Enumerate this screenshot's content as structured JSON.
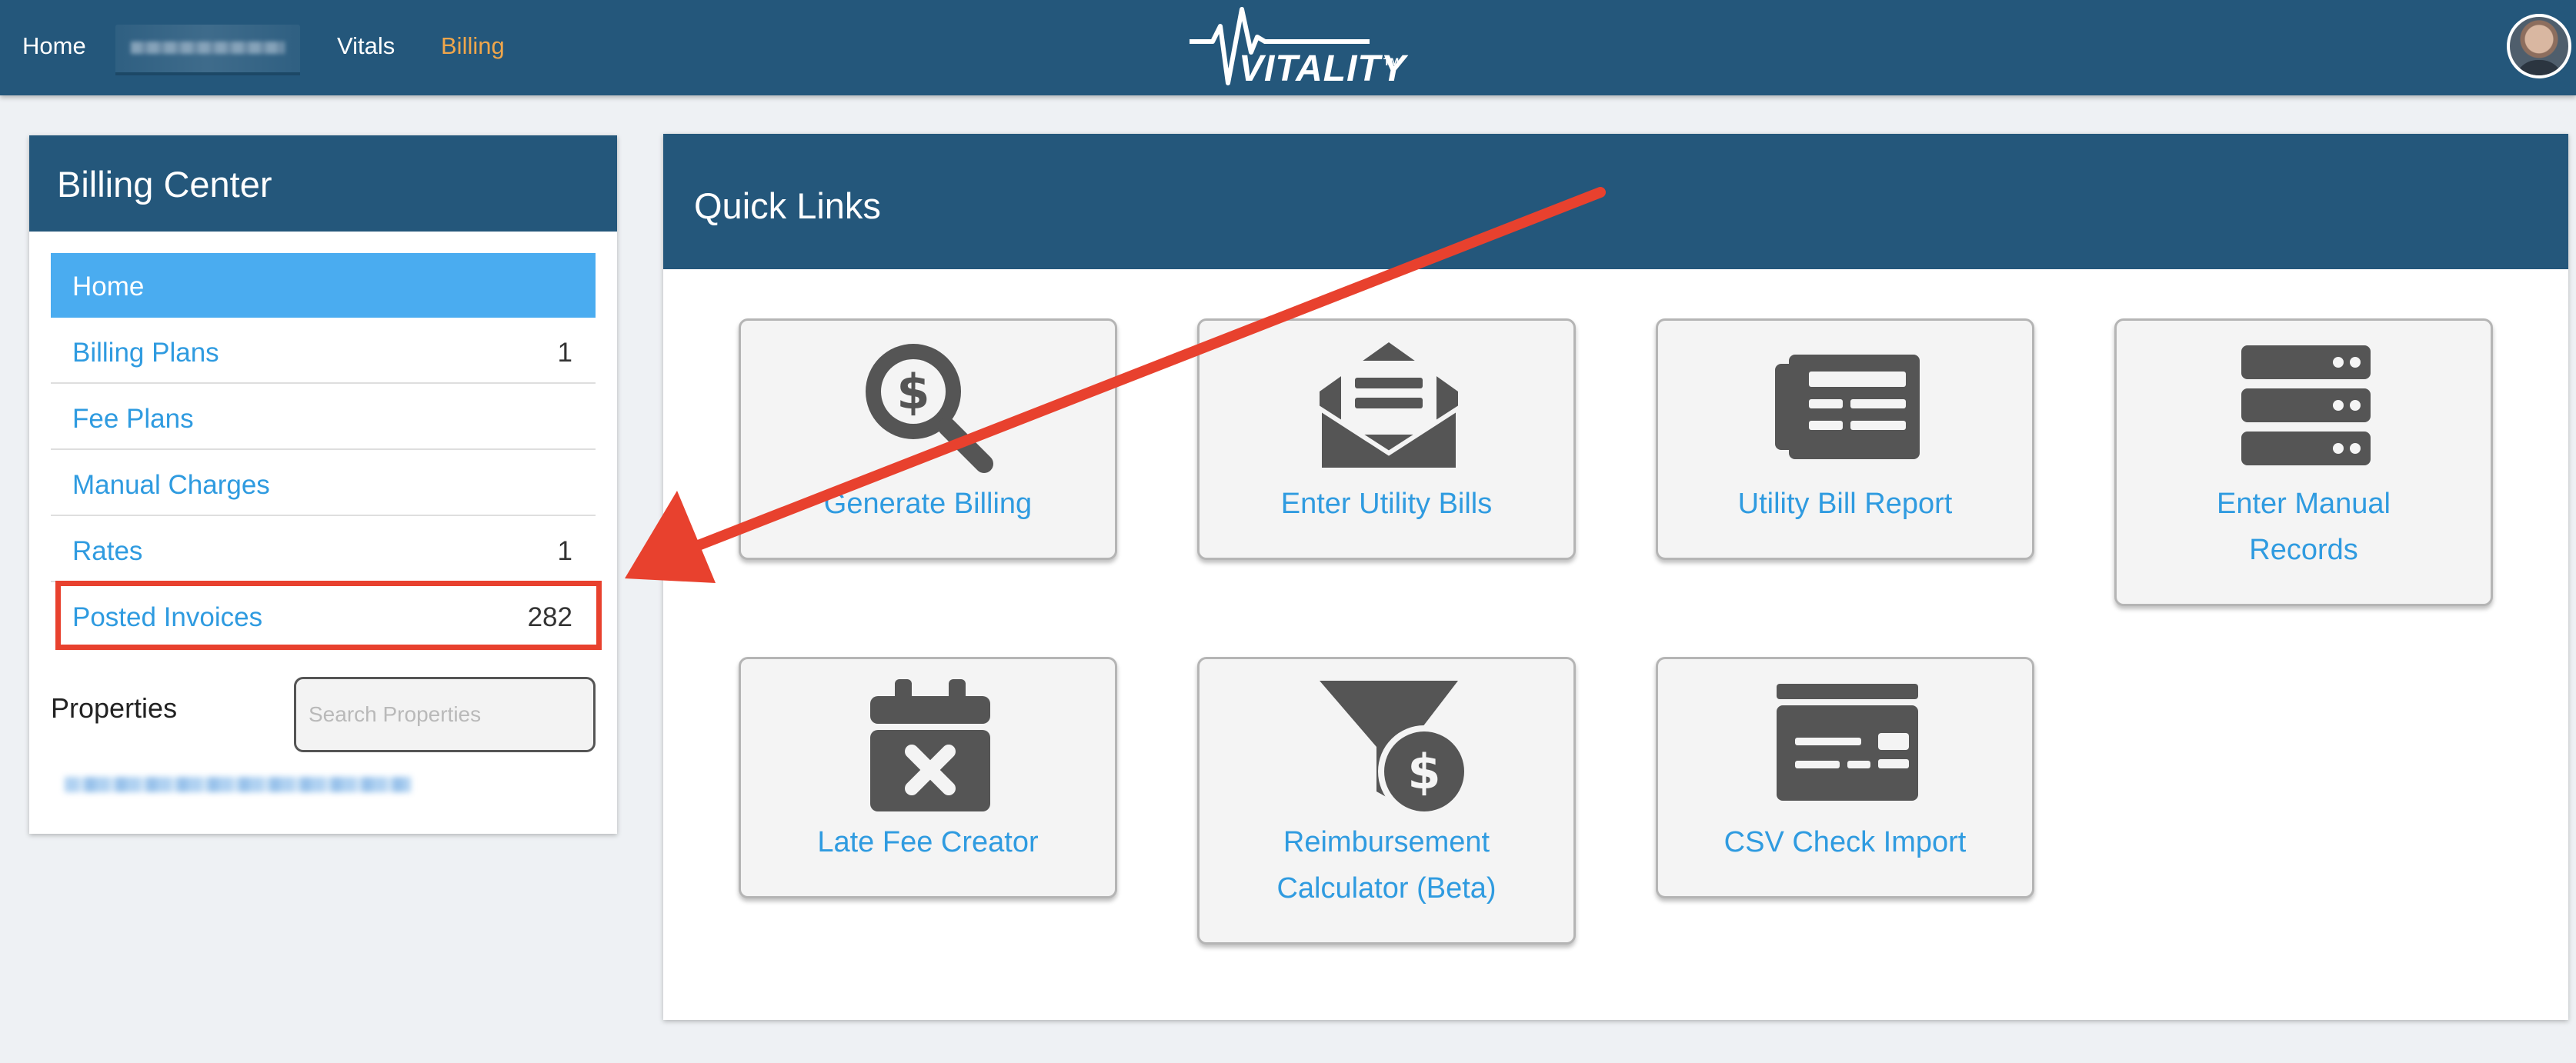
{
  "nav": {
    "home": "Home",
    "vitals": "Vitals",
    "billing": "Billing",
    "logo": "VITALITY",
    "logo_tm": "TM"
  },
  "billing_center": {
    "title": "Billing Center",
    "items": [
      {
        "label": "Home",
        "count": "",
        "active": true
      },
      {
        "label": "Billing Plans",
        "count": "1"
      },
      {
        "label": "Fee Plans",
        "count": ""
      },
      {
        "label": "Manual Charges",
        "count": ""
      },
      {
        "label": "Rates",
        "count": "1"
      },
      {
        "label": "Posted Invoices",
        "count": "282"
      }
    ],
    "properties_label": "Properties",
    "search_placeholder": "Search Properties"
  },
  "quick_links": {
    "title": "Quick Links",
    "tiles": [
      {
        "line1": "Generate Billing",
        "line2": "",
        "icon": "dollar-magnifier-icon"
      },
      {
        "line1": "Enter Utility Bills",
        "line2": "",
        "icon": "envelope-open-icon"
      },
      {
        "line1": "Utility Bill Report",
        "line2": "",
        "icon": "newspaper-icon"
      },
      {
        "line1": "Enter Manual",
        "line2": "Records",
        "icon": "server-icon"
      },
      {
        "line1": "Late Fee Creator",
        "line2": "",
        "icon": "calendar-x-icon"
      },
      {
        "line1": "Reimbursement",
        "line2": "Calculator (Beta)",
        "icon": "funnel-dollar-icon"
      },
      {
        "line1": "CSV Check Import",
        "line2": "",
        "icon": "money-check-icon"
      }
    ]
  },
  "colors": {
    "header": "#24577b",
    "accent_link": "#2f9be0",
    "active_nav": "#f0a64b",
    "active_menu": "#4aacf0",
    "annotation": "#e8412e",
    "icon": "#555555"
  }
}
